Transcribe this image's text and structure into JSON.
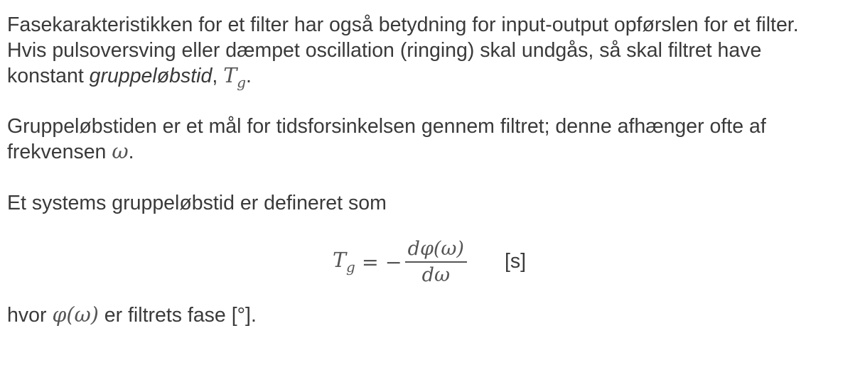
{
  "paragraph1": {
    "line1": "Fasekarakteristikken for et filter har også betydning for input-output opførslen for et filter.",
    "line2": "Hvis pulsoversving eller dæmpet oscillation (ringing) skal undgås, så skal filtret have",
    "line3_prefix": "konstant ",
    "line3_emph": "gruppeløbstid",
    "line3_comma": ", ",
    "line3_symbol": "T",
    "line3_sub": "g",
    "line3_end": "."
  },
  "paragraph2": {
    "line1": "Gruppeløbstiden er et mål for tidsforsinkelsen gennem filtret; denne afhænger ofte af",
    "line2_prefix": "frekvensen ",
    "line2_symbol": "ω",
    "line2_end": "."
  },
  "paragraph3": {
    "line1": "Et systems gruppeløbstid er defineret som"
  },
  "formula": {
    "lhs": "T",
    "lhs_sub": "g",
    "equals": " = −",
    "numerator": "dφ(ω)",
    "denominator": "dω",
    "unit": "[s]"
  },
  "paragraph4": {
    "prefix": "hvor ",
    "symbol": "φ(ω)",
    "suffix": " er filtrets fase [°]."
  }
}
